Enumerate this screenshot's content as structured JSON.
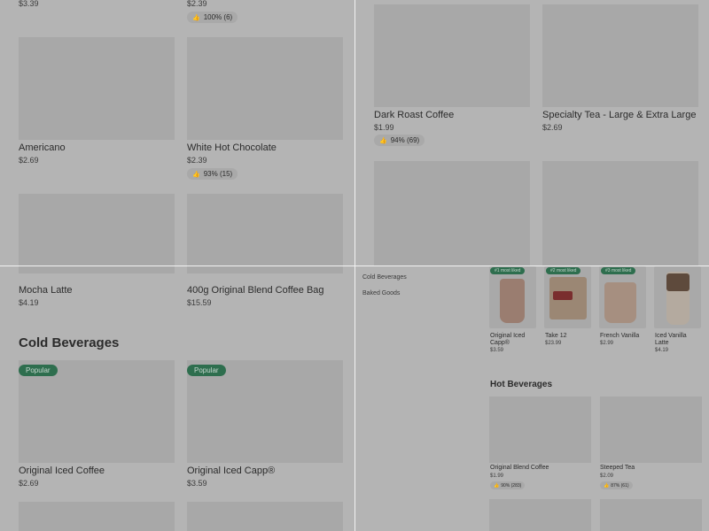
{
  "tl": {
    "top_prices": [
      "$3.39",
      "$2.39"
    ],
    "top_rating": "100% (6)",
    "items": [
      {
        "name": "Americano",
        "price": "$2.69"
      },
      {
        "name": "White Hot Chocolate",
        "price": "$2.39",
        "rating": "93% (15)"
      }
    ]
  },
  "tr": {
    "items": [
      {
        "name": "Dark Roast Coffee",
        "price": "$1.99",
        "rating": "94% (69)"
      },
      {
        "name": "Specialty Tea - Large & Extra Large",
        "price": "$2.69"
      }
    ]
  },
  "bl": {
    "items": [
      {
        "name": "Mocha Latte",
        "price": "$4.19"
      },
      {
        "name": "400g Original Blend Coffee Bag",
        "price": "$15.59"
      }
    ],
    "section_title": "Cold Beverages",
    "cold_items": [
      {
        "badge": "Popular",
        "name": "Original Iced Coffee",
        "price": "$2.69"
      },
      {
        "badge": "Popular",
        "name": "Original Iced Capp®",
        "price": "$3.59"
      }
    ]
  },
  "br": {
    "sidebar": [
      "Cold Beverages",
      "Baked Goods"
    ],
    "liked": [
      {
        "badge": "#1 most liked",
        "name": "Original Iced Capp®",
        "price": "$3.59"
      },
      {
        "badge": "#2 most liked",
        "name": "Take 12",
        "price": "$23.99"
      },
      {
        "badge": "#3 most liked",
        "name": "French Vanilla",
        "price": "$2.99"
      },
      {
        "name": "Iced Vanilla Latte",
        "price": "$4.19"
      }
    ],
    "section_title": "Hot Beverages",
    "hot_items": [
      {
        "name": "Original Blend Coffee",
        "price": "$1.99",
        "rating": "90% (283)"
      },
      {
        "name": "Steeped Tea",
        "price": "$2.09",
        "rating": "87% (61)"
      }
    ],
    "thumb_icon": "thumbs-up-icon"
  }
}
